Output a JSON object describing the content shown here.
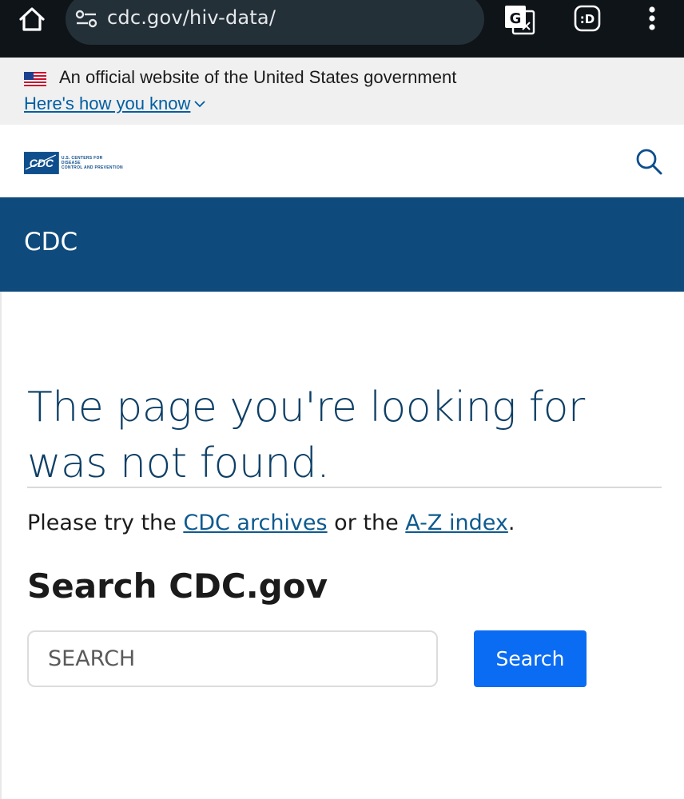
{
  "browser": {
    "url": "cdc.gov/hiv-data/",
    "reader_label": ":D",
    "translate_label": "G"
  },
  "gov_banner": {
    "text": "An official website of the United States government",
    "link_label": "Here's how you know"
  },
  "header": {
    "logo_badge": "CDC",
    "logo_line1": "U.S. CENTERS FOR DISEASE",
    "logo_line2": "CONTROL AND PREVENTION"
  },
  "band": {
    "title": "CDC"
  },
  "main": {
    "heading": "The page you're looking for was not found.",
    "try_prefix": "Please try the ",
    "archives_link": "CDC archives",
    "try_middle": " or the ",
    "az_link": "A-Z index",
    "try_suffix": ".",
    "search_heading": "Search CDC.gov",
    "search_placeholder": "SEARCH",
    "search_button": "Search"
  },
  "colors": {
    "chrome_bg": "#0f1419",
    "banner_bg": "#f0f0f0",
    "band_bg": "#0e4a7b",
    "heading": "#0e3f66",
    "link": "#005ea2",
    "button": "#0a6cf2"
  },
  "icons": [
    "home-icon",
    "tune-icon",
    "translate-icon",
    "reader-mode-icon",
    "more-vert-icon",
    "us-flag-icon",
    "chevron-down-icon",
    "search-icon"
  ]
}
